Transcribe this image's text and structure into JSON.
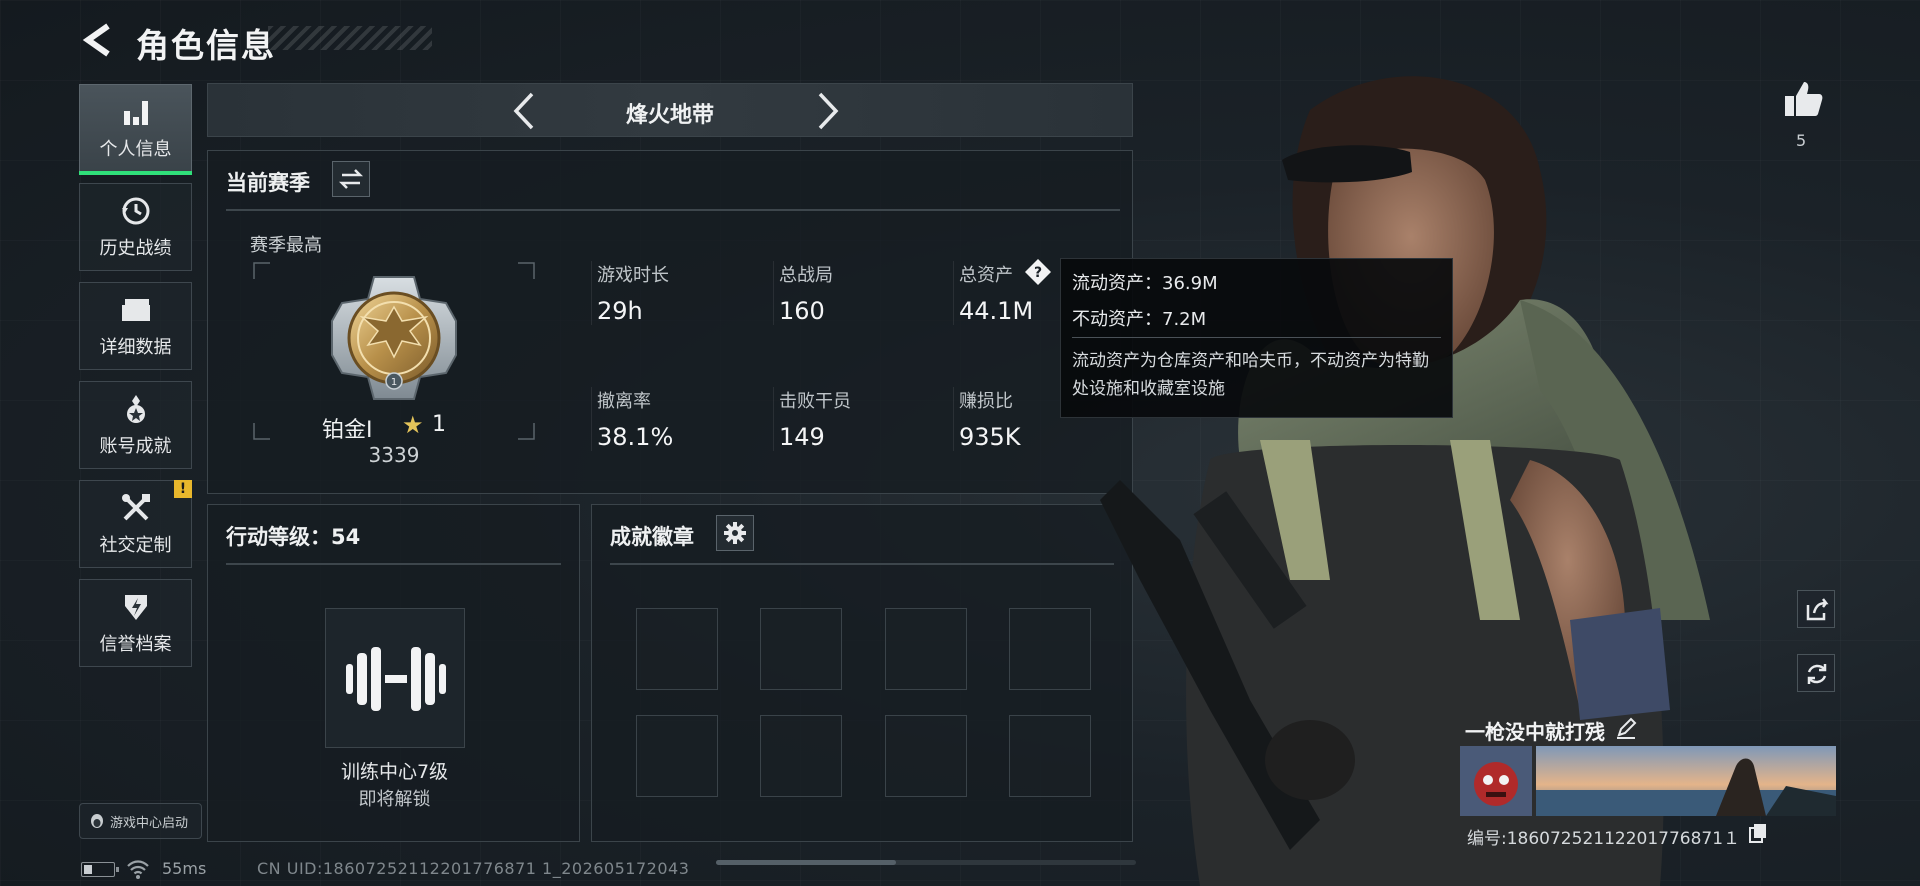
{
  "header": {
    "title": "角色信息"
  },
  "sidebar": {
    "items": [
      {
        "label": "个人信息",
        "icon": "bar-chart-icon",
        "active": true
      },
      {
        "label": "历史战绩",
        "icon": "clock-icon",
        "active": false
      },
      {
        "label": "详细数据",
        "icon": "folder-icon",
        "active": false
      },
      {
        "label": "账号成就",
        "icon": "medal-icon",
        "active": false
      },
      {
        "label": "社交定制",
        "icon": "tools-icon",
        "active": false,
        "warning": "!"
      },
      {
        "label": "信誉档案",
        "icon": "shield-icon",
        "active": false
      }
    ],
    "game_center": "游戏中心启动"
  },
  "mode": {
    "title": "烽火地带"
  },
  "season": {
    "title": "当前赛季",
    "best_label": "赛季最高",
    "rank_name": "铂金Ⅰ",
    "rank_stars": "1",
    "rank_score": "3339",
    "stats": [
      {
        "label": "游戏时长",
        "value": "29h"
      },
      {
        "label": "总战局",
        "value": "160"
      },
      {
        "label": "总资产",
        "value": "44.1M"
      },
      {
        "label": "撤离率",
        "value": "38.1%"
      },
      {
        "label": "击败干员",
        "value": "149"
      },
      {
        "label": "赚损比",
        "value": "935K"
      }
    ]
  },
  "tooltip": {
    "liquid": "流动资产：36.9M",
    "fixed": "不动资产：7.2M",
    "desc": "流动资产为仓库资产和哈夫币，不动资产为特勤处设施和收藏室设施"
  },
  "action_level": {
    "title": "行动等级：54",
    "training_name": "训练中心7级",
    "training_sub": "即将解锁"
  },
  "badges": {
    "title": "成就徽章",
    "slot_count": 8
  },
  "profile": {
    "likes": "5",
    "player_name": "一枪没中就打残",
    "player_id": "编号:18607252112201776871１"
  },
  "status": {
    "ping": "55ms",
    "uid": "CN UID:18607252112201776871 1_202605172043",
    "battery_level": 0.3
  },
  "colors": {
    "accent": "#30e07a",
    "warning": "#e8b72c",
    "gold": "#e4c45a"
  }
}
